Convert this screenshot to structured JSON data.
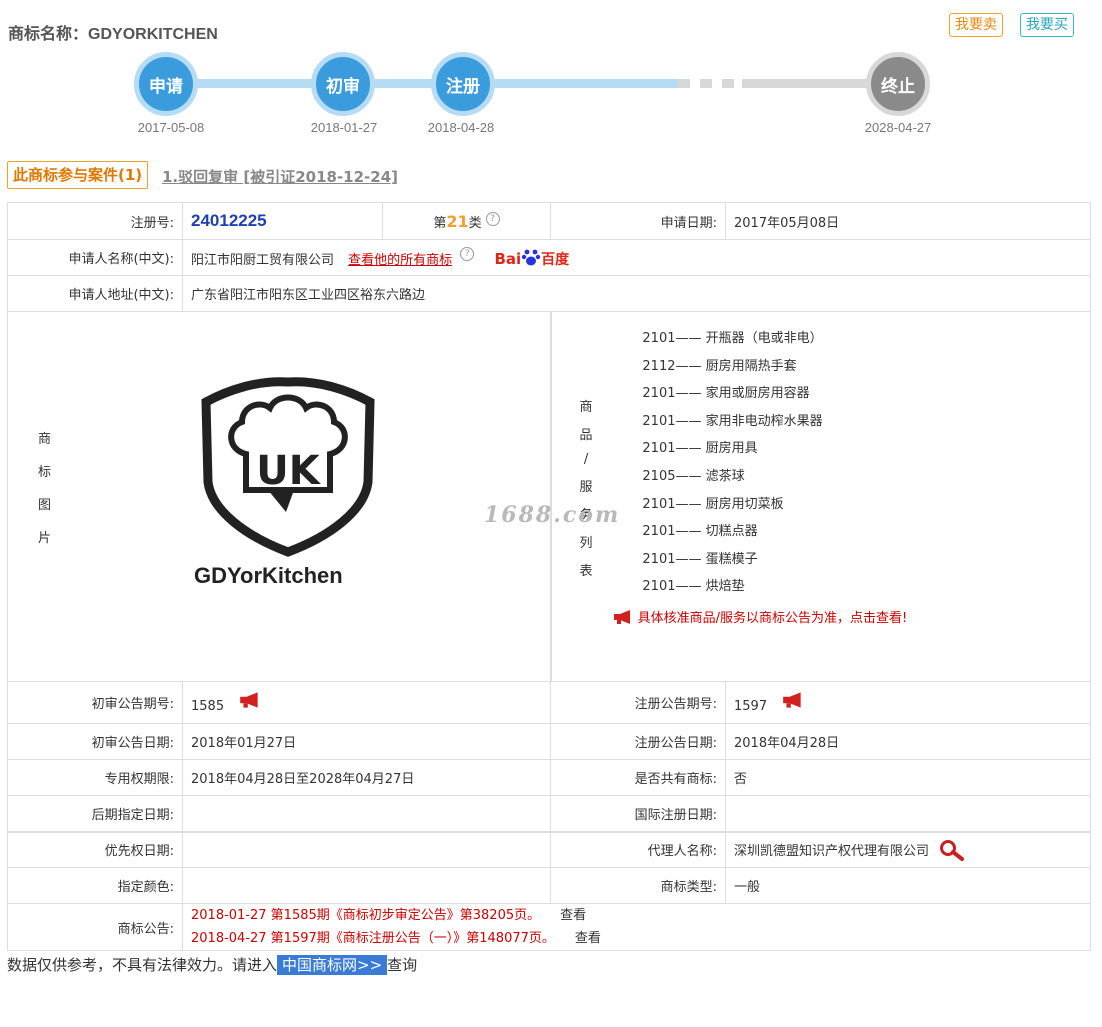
{
  "header": {
    "title_label": "商标名称：",
    "title_value": "GDYORKITCHEN",
    "sell": "我要卖",
    "buy": "我要买"
  },
  "timeline": [
    {
      "label": "申请",
      "date": "2017-05-08"
    },
    {
      "label": "初审",
      "date": "2018-01-27"
    },
    {
      "label": "注册",
      "date": "2018-04-28"
    },
    {
      "label": "终止",
      "date": "2028-04-27"
    }
  ],
  "cases": {
    "tab": "此商标参与案件(1)",
    "link": "1.驳回复审 [被引证2018-12-24]"
  },
  "info": {
    "reg_no_label": "注册号:",
    "reg_no": "24012225",
    "class_prefix": "第",
    "class_num": "21",
    "class_suffix": "类",
    "apply_date_label": "申请日期:",
    "apply_date": "2017年05月08日",
    "applicant_label": "申请人名称(中文):",
    "applicant": "阳江市阳厨工贸有限公司",
    "all_marks": "查看他的所有商标",
    "baidu_a": "Bai",
    "baidu_b": "百度",
    "address_label": "申请人地址(中文):",
    "address": "广东省阳江市阳东区工业四区裕东六路边",
    "image_label": [
      "商",
      "标",
      "图",
      "片"
    ],
    "logo_text": "GDYorKitchen",
    "goods_label": [
      "商",
      "品",
      "/",
      "服",
      "务",
      "列",
      "表"
    ],
    "goods": [
      {
        "code": "2101",
        "name": "开瓶器（电或非电）"
      },
      {
        "code": "2112",
        "name": "厨房用隔热手套"
      },
      {
        "code": "2101",
        "name": "家用或厨房用容器"
      },
      {
        "code": "2101",
        "name": "家用非电动榨水果器"
      },
      {
        "code": "2101",
        "name": "厨房用具"
      },
      {
        "code": "2105",
        "name": "滤茶球"
      },
      {
        "code": "2101",
        "name": "厨房用切菜板"
      },
      {
        "code": "2101",
        "name": "切糕点器"
      },
      {
        "code": "2101",
        "name": "蛋糕模子"
      },
      {
        "code": "2101",
        "name": "烘焙垫"
      }
    ],
    "goods_dash": "——",
    "goods_note": "具体核准商品/服务以商标公告为准，点击查看!",
    "watermark": "1688.com",
    "prelim_no_label": "初审公告期号:",
    "prelim_no": "1585",
    "reg_pub_no_label": "注册公告期号:",
    "reg_pub_no": "1597",
    "prelim_date_label": "初审公告日期:",
    "prelim_date": "2018年01月27日",
    "reg_pub_date_label": "注册公告日期:",
    "reg_pub_date": "2018年04月28日",
    "exclusive_label": "专用权期限:",
    "exclusive": "2018年04月28日至2028年04月27日",
    "shared_label": "是否共有商标:",
    "shared": "否",
    "later_label": "后期指定日期:",
    "later": "",
    "intl_label": "国际注册日期:",
    "intl": "",
    "priority_label": "优先权日期:",
    "priority": "",
    "agent_label": "代理人名称:",
    "agent": "深圳凯德盟知识产权代理有限公司",
    "color_label": "指定颜色:",
    "color": "",
    "type_label": "商标类型:",
    "type": "一般",
    "notice_label": "商标公告:",
    "notices": [
      {
        "text": "2018-01-27 第1585期《商标初步审定公告》第38205页。",
        "view": "查看"
      },
      {
        "text": "2018-04-27 第1597期《商标注册公告（一）》第148077页。",
        "view": "查看"
      }
    ]
  },
  "footer": {
    "text1": "数据仅供参考，不具有法律效力。请进入",
    "link": "中国商标网>>",
    "text2": "查询"
  },
  "colors": {
    "accent": "#3a9cdc",
    "orange": "#f0a030",
    "red": "#cc0000",
    "teal": "#25a5b8"
  }
}
